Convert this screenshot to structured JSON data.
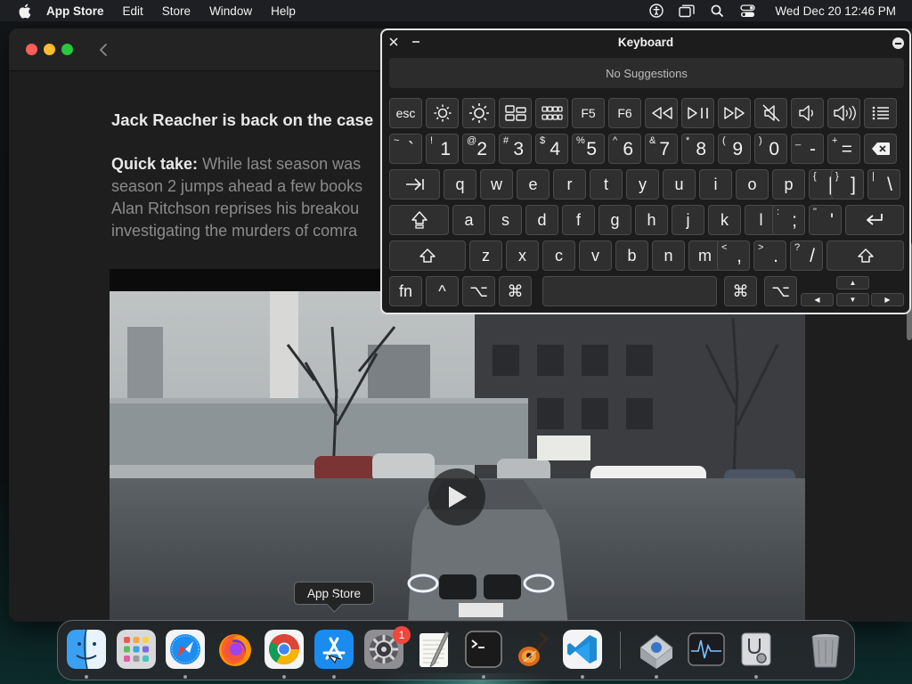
{
  "menubar": {
    "app_name": "App Store",
    "items": [
      "Edit",
      "Store",
      "Window",
      "Help"
    ],
    "clock": "Wed Dec 20  12:46 PM"
  },
  "article": {
    "headline": "Jack Reacher is back on the case",
    "lead": "Quick take:",
    "lines": [
      "While last season was",
      "season 2 jumps ahead a few books",
      "Alan Ritchson reprises his breakou",
      "investigating the murders of comra"
    ]
  },
  "keyboard": {
    "title": "Keyboard",
    "suggestions": "No Suggestions",
    "labels": {
      "esc": "esc",
      "f5": "F5",
      "f6": "F6",
      "fn": "fn",
      "control": "^",
      "option": "⌥",
      "command": "⌘"
    },
    "number_row": [
      {
        "s": "~",
        "m": "`"
      },
      {
        "s": "!",
        "m": "1"
      },
      {
        "s": "@",
        "m": "2"
      },
      {
        "s": "#",
        "m": "3"
      },
      {
        "s": "$",
        "m": "4"
      },
      {
        "s": "%",
        "m": "5"
      },
      {
        "s": "^",
        "m": "6"
      },
      {
        "s": "&",
        "m": "7"
      },
      {
        "s": "*",
        "m": "8"
      },
      {
        "s": "(",
        "m": "9"
      },
      {
        "s": ")",
        "m": "0"
      },
      {
        "s": "_",
        "m": "-"
      },
      {
        "s": "+",
        "m": "="
      }
    ],
    "qwerty_row": [
      "q",
      "w",
      "e",
      "r",
      "t",
      "y",
      "u",
      "i",
      "o",
      "p"
    ],
    "qwerty_row_symbols": [
      {
        "s": "{",
        "m": "["
      },
      {
        "s": "}",
        "m": "]"
      },
      {
        "s": "|",
        "m": "\\"
      }
    ],
    "home_row": [
      "a",
      "s",
      "d",
      "f",
      "g",
      "h",
      "j",
      "k",
      "l"
    ],
    "home_row_symbols": [
      {
        "s": ":",
        "m": ";"
      },
      {
        "s": "\"",
        "m": "'"
      }
    ],
    "bottom_row": [
      "z",
      "x",
      "c",
      "v",
      "b",
      "n",
      "m"
    ],
    "bottom_row_symbols": [
      {
        "s": "<",
        "m": ","
      },
      {
        "s": ">",
        "m": "."
      },
      {
        "s": "?",
        "m": "/"
      }
    ]
  },
  "tooltip": "App Store",
  "dock": {
    "items": [
      "Finder",
      "Launchpad",
      "Safari",
      "Firefox",
      "Google Chrome",
      "App Store",
      "System Settings",
      "TextEdit",
      "Terminal",
      "GarageBand",
      "Visual Studio Code",
      "Migration Assistant",
      "Activity Monitor",
      "Disk Utility",
      "Trash"
    ],
    "system_settings_badge": "1"
  },
  "colors": {
    "close": "#fe5f57",
    "minimize": "#febc2e",
    "maximize": "#28c840",
    "badge": "#f2463d"
  }
}
